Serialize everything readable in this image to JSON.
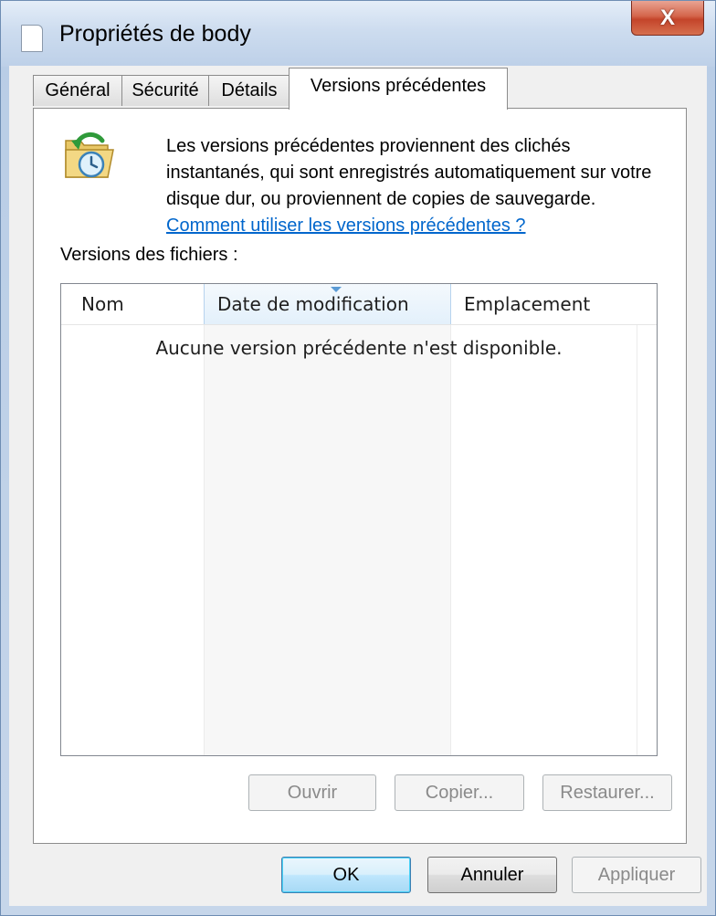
{
  "window": {
    "title": "Propriétés de body",
    "close_glyph": "X"
  },
  "tabs": [
    {
      "label": "Général",
      "active": false
    },
    {
      "label": "Sécurité",
      "active": false
    },
    {
      "label": "Détails",
      "active": false
    },
    {
      "label": "Versions précédentes",
      "active": true
    }
  ],
  "info": {
    "icon": "previous-versions-folder-icon",
    "description_lines": [
      "Les versions précédentes proviennent des clichés",
      "instantanés, qui sont enregistrés automatiquement sur votre",
      "disque dur, ou proviennent de copies de sauvegarde."
    ],
    "help_link": "Comment utiliser les versions précédentes ?"
  },
  "file_versions": {
    "label": "Versions des fichiers :",
    "columns": [
      "Nom",
      "Date de modification",
      "Emplacement"
    ],
    "sorted_column": "Date de modification",
    "empty_message": "Aucune version précédente n'est disponible."
  },
  "action_buttons": {
    "open": "Ouvrir",
    "copy": "Copier...",
    "restore": "Restaurer..."
  },
  "dialog_buttons": {
    "ok": "OK",
    "cancel": "Annuler",
    "apply": "Appliquer"
  },
  "colors": {
    "link": "#0066cc",
    "close_button": "#c4442a",
    "default_button_border": "#3c7fb1"
  }
}
